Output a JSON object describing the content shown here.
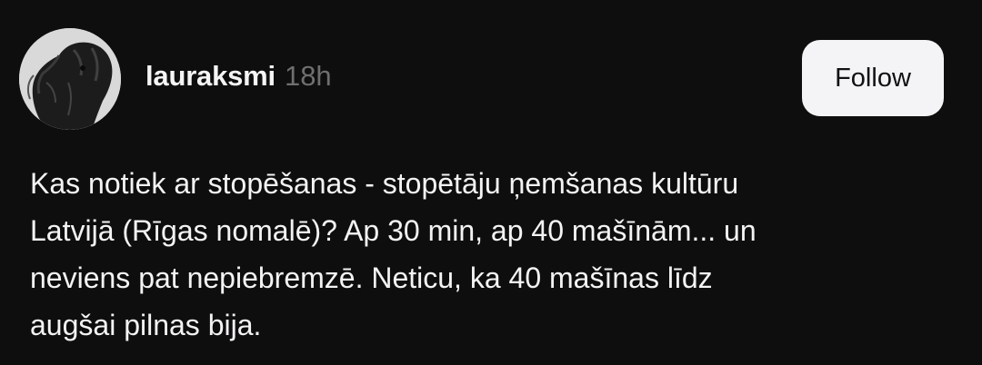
{
  "post": {
    "author": {
      "username": "lauraksmi",
      "timestamp": "18h",
      "avatar_icon": "dog-avatar-icon"
    },
    "follow_label": "Follow",
    "body_lines": [
      "Kas notiek ar stopēšanas - stopētāju ņemšanas kultūru",
      "Latvijā (Rīgas nomalē)? Ap 30 min, ap 40 mašīnām... un",
      "neviens pat nepiebremzē. Neticu, ka 40 mašīnas līdz",
      "augšai pilnas bija."
    ]
  },
  "colors": {
    "background": "#0f0e0f",
    "text": "#f3f3f3",
    "muted": "#6f6f6f",
    "button_bg": "#f4f4f6",
    "button_text": "#111111"
  }
}
